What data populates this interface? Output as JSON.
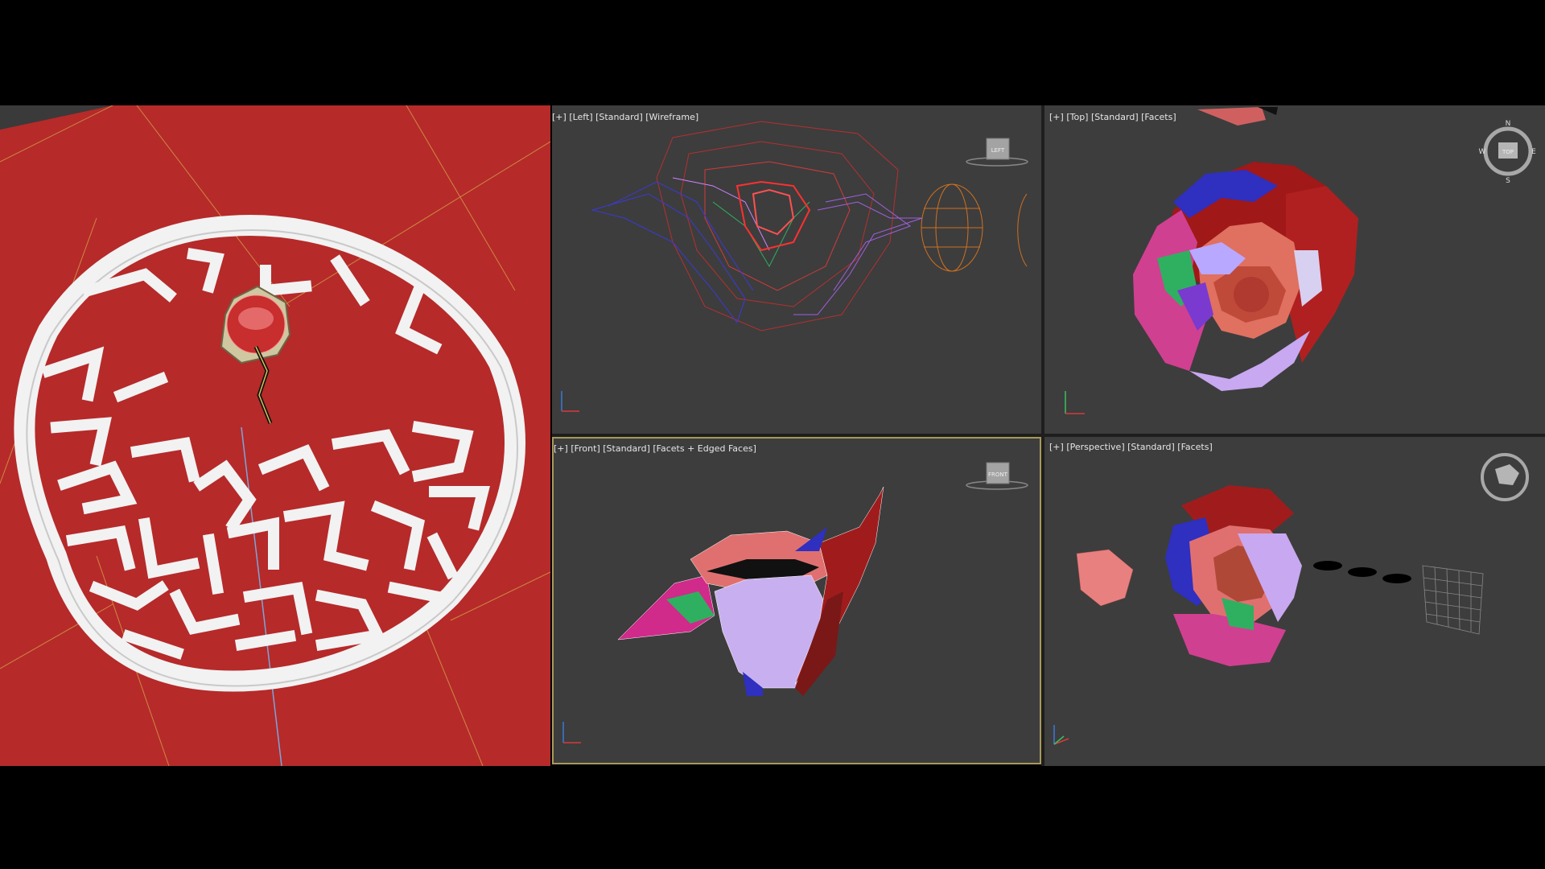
{
  "viewports": {
    "left": {
      "plus": "+",
      "name": "Left",
      "style": "Standard",
      "shading": "Wireframe",
      "viewcube": "LEFT"
    },
    "top": {
      "plus": "+",
      "name": "Top",
      "style": "Standard",
      "shading": "Facets",
      "viewcube": "TOP",
      "compass": {
        "n": "N",
        "s": "S",
        "e": "E",
        "w": "W"
      }
    },
    "front": {
      "plus": "+",
      "name": "Front",
      "style": "Standard",
      "shading": "Facets + Edged Faces",
      "viewcube": "FRONT"
    },
    "perspective": {
      "plus": "+",
      "name": "Perspective",
      "style": "Standard",
      "shading": "Facets"
    }
  },
  "colors": {
    "viewport_bg": "#3d3d3d",
    "ground_red": "#b62a2a",
    "active_border": "#a89a58",
    "label_text": "#e6e6e6"
  },
  "icons": [
    "viewcube-icon",
    "compass-icon",
    "axis-gizmo-icon",
    "grid-icon"
  ]
}
